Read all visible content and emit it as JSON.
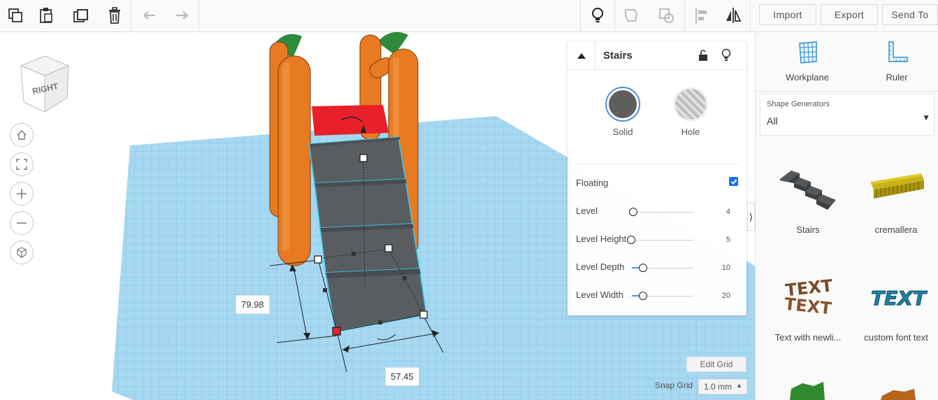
{
  "toolbar": {
    "import_label": "Import",
    "export_label": "Export",
    "send_to_label": "Send To"
  },
  "viewcube": {
    "face_label": "RIGHT"
  },
  "dimensions": {
    "depth": "79.98",
    "width": "57.45"
  },
  "inspector": {
    "title": "Stairs",
    "solid_label": "Solid",
    "hole_label": "Hole",
    "solid_color": "#5e5e5e",
    "properties": [
      {
        "label": "Floating",
        "type": "checkbox",
        "checked": true
      },
      {
        "label": "Level",
        "value": "4"
      },
      {
        "label": "Level Height",
        "value": "5"
      },
      {
        "label": "Level Depth",
        "value": "10"
      },
      {
        "label": "Level Width",
        "value": "20"
      }
    ]
  },
  "grid": {
    "edit_grid_label": "Edit Grid",
    "snap_grid_label": "Snap Grid",
    "snap_value": "1.0 mm"
  },
  "right_panel": {
    "workplane_label": "Workplane",
    "ruler_label": "Ruler",
    "generators_title": "Shape Generators",
    "generators_value": "All",
    "shapes": [
      {
        "label": "Stairs"
      },
      {
        "label": "cremallera"
      },
      {
        "label": "Text with newli..."
      },
      {
        "label": "custom font text"
      }
    ]
  },
  "colors": {
    "accent": "#1a73e8",
    "grid_blue": "#9fd3ef",
    "stairs_gray": "#5a5d60",
    "carrot_orange": "#e87a22",
    "top_red": "#e8202a"
  }
}
